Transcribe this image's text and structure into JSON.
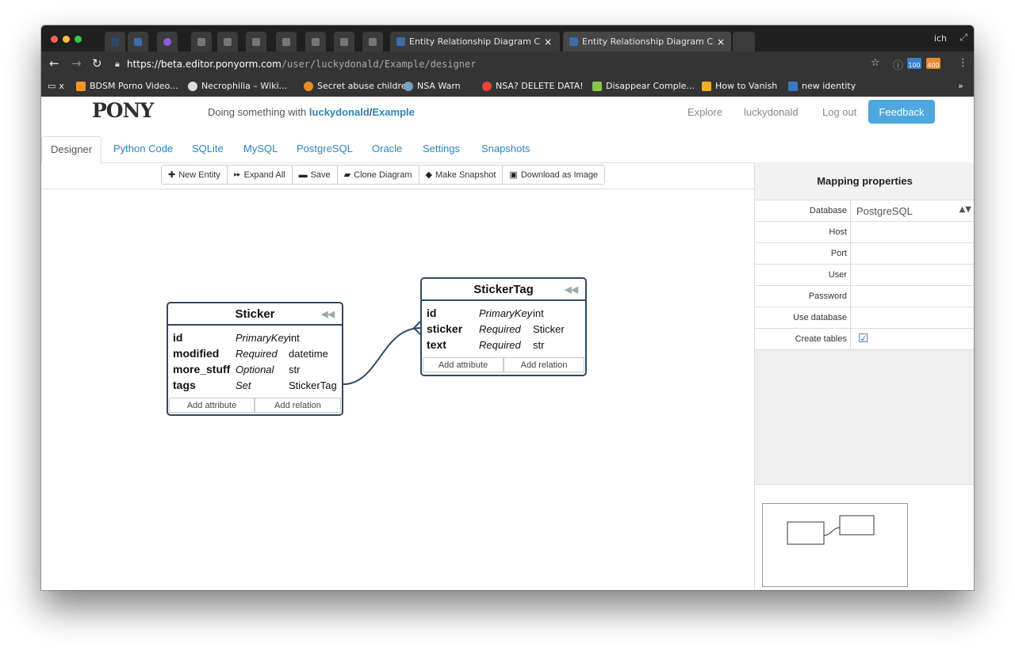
{
  "browser": {
    "tabs": [
      {
        "title": "Entity Relationship Diagram C"
      },
      {
        "title": "Entity Relationship Diagram C"
      }
    ],
    "profile": "ich",
    "url": {
      "proto": "https://",
      "host": "beta.editor.ponyorm.com",
      "path": "/user/luckydonald/Example/designer"
    },
    "ext_badges": [
      "100",
      "400"
    ],
    "bookmarks": [
      "x",
      "BDSM Porno Video...",
      "Necrophilia – Wiki...",
      "Secret abuse children",
      "NSA Warn",
      "NSA? DELETE DATA!",
      "Disappear Comple...",
      "How to Vanish",
      "new identity"
    ],
    "bookmarks_overflow": "»"
  },
  "header": {
    "logo": "PONY",
    "doing_prefix": "Doing something with ",
    "user": "luckydonald",
    "slash": "/",
    "project": "Example",
    "explore": "Explore",
    "username": "luckydonald",
    "logout": "Log out",
    "feedback": "Feedback"
  },
  "tabs": [
    "Designer",
    "Python Code",
    "SQLite",
    "MySQL",
    "PostgreSQL",
    "Oracle",
    "Settings",
    "Snapshots"
  ],
  "toolbar": {
    "new_entity": "New Entity",
    "expand_all": "Expand All",
    "save": "Save",
    "clone": "Clone Diagram",
    "snapshot": "Make Snapshot",
    "download": "Download as Image"
  },
  "entities": {
    "sticker": {
      "name": "Sticker",
      "attrs": [
        {
          "name": "id",
          "kind": "PrimaryKey",
          "type": "int"
        },
        {
          "name": "modified",
          "kind": "Required",
          "type": "datetime"
        },
        {
          "name": "more_stuff",
          "kind": "Optional",
          "type": "str"
        },
        {
          "name": "tags",
          "kind": "Set",
          "type": "StickerTag"
        }
      ],
      "add_attribute": "Add attribute",
      "add_relation": "Add relation"
    },
    "stickertag": {
      "name": "StickerTag",
      "attrs": [
        {
          "name": "id",
          "kind": "PrimaryKey",
          "type": "int"
        },
        {
          "name": "sticker",
          "kind": "Required",
          "type": "Sticker"
        },
        {
          "name": "text",
          "kind": "Required",
          "type": "str"
        }
      ],
      "add_attribute": "Add attribute",
      "add_relation": "Add relation"
    }
  },
  "mapping": {
    "title": "Mapping properties",
    "rows": [
      {
        "label": "Database",
        "value": "PostgreSQL"
      },
      {
        "label": "Host",
        "value": ""
      },
      {
        "label": "Port",
        "value": ""
      },
      {
        "label": "User",
        "value": ""
      },
      {
        "label": "Password",
        "value": ""
      },
      {
        "label": "Use database",
        "value": ""
      },
      {
        "label": "Create tables",
        "value": "☑"
      }
    ]
  }
}
